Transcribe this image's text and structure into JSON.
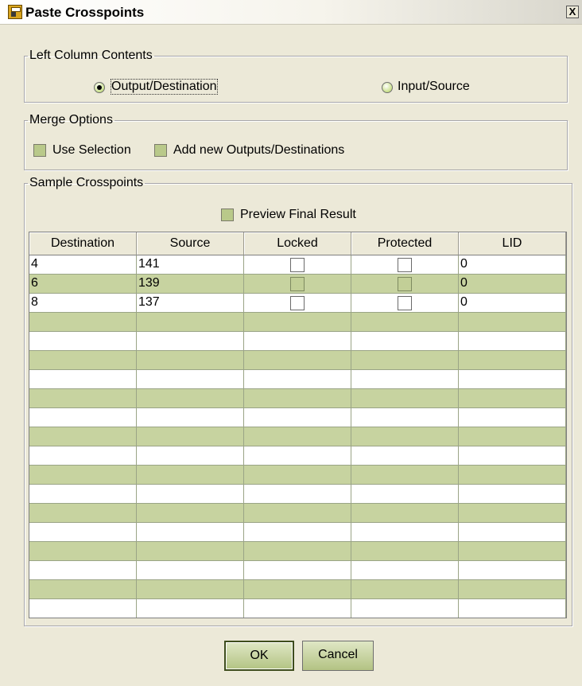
{
  "window": {
    "title": "Paste Crosspoints",
    "close_label": "X"
  },
  "left_column": {
    "legend": "Left Column Contents",
    "options": [
      {
        "label": "Output/Destination",
        "selected": true
      },
      {
        "label": "Input/Source",
        "selected": false
      }
    ]
  },
  "merge": {
    "legend": "Merge Options",
    "use_selection": {
      "label": "Use Selection",
      "checked": false
    },
    "add_new": {
      "label": "Add new Outputs/Destinations",
      "checked": false
    }
  },
  "sample": {
    "legend": "Sample Crosspoints",
    "preview": {
      "label": "Preview Final Result",
      "checked": false
    }
  },
  "table": {
    "columns": [
      "Destination",
      "Source",
      "Locked",
      "Protected",
      "LID"
    ],
    "rows": [
      {
        "destination": "4",
        "source": "141",
        "locked": false,
        "protected": false,
        "lid": "0"
      },
      {
        "destination": "6",
        "source": "139",
        "locked": false,
        "protected": false,
        "lid": "0"
      },
      {
        "destination": "8",
        "source": "137",
        "locked": false,
        "protected": false,
        "lid": "0"
      }
    ]
  },
  "buttons": {
    "ok": "OK",
    "cancel": "Cancel"
  },
  "colors": {
    "row_alt": "#c7d3a0",
    "dialog_bg": "#ece9d8"
  }
}
